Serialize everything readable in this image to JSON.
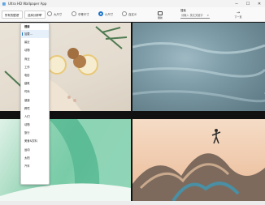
{
  "window": {
    "title": "Ultra HD Wallpaper App",
    "minimize_glyph": "─",
    "maximize_glyph": "☐",
    "close_glyph": "✕"
  },
  "toolbar": {
    "category_dropdown": {
      "value": "所有的壁纸"
    },
    "resolution_dropdown": {
      "value": "选择分辨率"
    },
    "size_options": [
      {
        "label": "大尺寸",
        "selected": false
      },
      {
        "label": "中等尺寸",
        "selected": false
      },
      {
        "label": "小尺寸",
        "selected": true
      },
      {
        "label": "自定义",
        "selected": false
      }
    ],
    "refresh_label": "刷新",
    "next_label": "下一页",
    "search": {
      "label": "搜索",
      "placeholder": "请输入 英文关键字"
    }
  },
  "category_list": {
    "header": "搜索",
    "items": [
      "加载...",
      "最近",
      "动物",
      "商业",
      "工作",
      "电影",
      "建筑",
      "时尚",
      "健康",
      "跨境",
      "人们",
      "动物",
      "旅行",
      "美食&饮料",
      "运动",
      "太阳",
      "汽车"
    ],
    "selected_index": 0
  }
}
